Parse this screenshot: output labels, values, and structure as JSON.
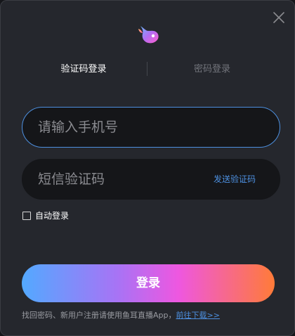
{
  "tabs": {
    "sms_login": "验证码登录",
    "password_login": "密码登录"
  },
  "phone_field": {
    "value": "",
    "placeholder": "请输入手机号"
  },
  "code_field": {
    "value": "",
    "placeholder": "短信验证码",
    "send_code_label": "发送验证码"
  },
  "auto_login": {
    "label": "自动登录",
    "checked": false
  },
  "login_button": {
    "label": "登录"
  },
  "footer": {
    "text": "找回密码、新用户注册请使用鱼耳直播App，",
    "link_label": "前往下载>>"
  },
  "icons": {
    "close": "close-icon",
    "logo": "fish-ear-logo-icon"
  },
  "colors": {
    "accent": "#4d90e0",
    "gradient_start": "#53a9ff",
    "gradient_end": "#ff7b38",
    "background": "#25272d"
  }
}
